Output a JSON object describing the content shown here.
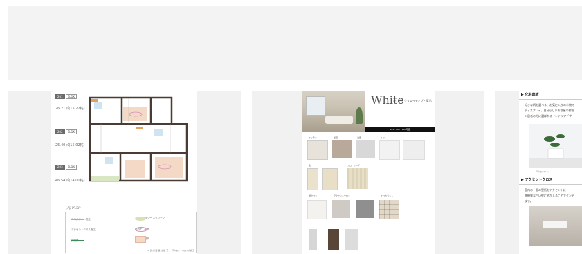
{
  "cards": [
    {
      "kind": "floor-plan",
      "units": [
        {
          "no": "201",
          "ldk": "1LDK",
          "area": "26.21㎡(15.22帖)"
        },
        {
          "no": "202",
          "ldk": "1LDK",
          "area": "25.40㎡(15.02帖)"
        },
        {
          "no": "203",
          "ldk": "1LDK",
          "area": "46.54㎡(14.01帖)"
        }
      ],
      "legend_title": "凡 Plan",
      "legend": [
        "エコカラット施工",
        "ドライフラワー\nスクリーン",
        "アクセントクロス施工",
        "室内干し金具",
        "床暖房",
        "デザイン照明"
      ],
      "footer": "※ 表 記 面 積 は 壁 芯 、 アクセントクロスの施工"
    },
    {
      "kind": "materials",
      "logo": "White",
      "subtitle": "爽しさとクリエイティブと気品",
      "bar_text": "201・202・203号室",
      "sections": [
        "キッチン",
        "浴室",
        "洗面",
        "トイレ",
        "扉",
        "フローリング",
        "壁クロス",
        "アクセントクロス",
        "エコカラット"
      ]
    },
    {
      "kind": "text",
      "heading1": "▶ 化粧扉板",
      "para1": [
        "好きな柄を選べる、お気に入りの小物で",
        "ディスプレイ、自分らしいお部屋の雰囲",
        "入居者の方に選ばれるインテリアデザ"
      ],
      "caption": "アクセホワイト",
      "heading2": "▶ アクセントクロス",
      "para2": [
        "室内の一面の壁紙をアクセントに",
        "無機質な白い壁に柄が入ることでインテ",
        "ます。"
      ]
    }
  ],
  "colors": {
    "banner": "#f3f3f3",
    "card_bg": "#f1f1f1",
    "wall": "#4a3b34"
  }
}
